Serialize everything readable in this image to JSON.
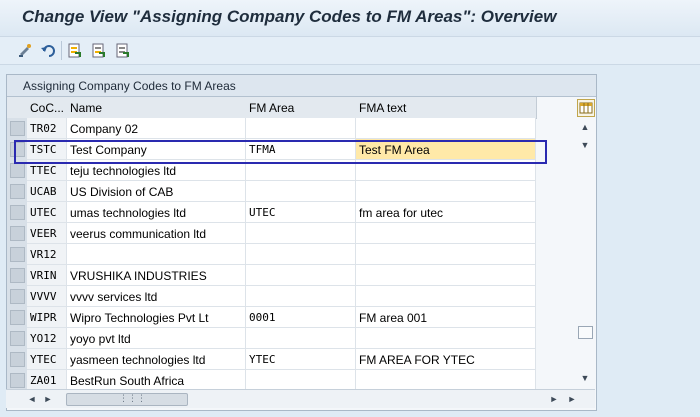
{
  "window": {
    "title": "Change View \"Assigning Company Codes to FM Areas\": Overview"
  },
  "toolbar": {
    "buttons": [
      {
        "icon": "display-change-icon"
      },
      {
        "icon": "undo-icon"
      },
      {
        "icon": "select-all-icon"
      },
      {
        "icon": "select-block-icon"
      },
      {
        "icon": "deselect-all-icon"
      }
    ]
  },
  "table": {
    "title": "Assigning Company Codes to FM Areas",
    "columns": [
      "CoC...",
      "Name",
      "FM Area",
      "FMA text"
    ],
    "rows": [
      {
        "code": "TR02",
        "name": "Company 02",
        "fm_area": "",
        "fma_text": ""
      },
      {
        "code": "TSTC",
        "name": "Test Company",
        "fm_area": "TFMA",
        "fma_text": "Test FM Area"
      },
      {
        "code": "TTEC",
        "name": "teju technologies ltd",
        "fm_area": "",
        "fma_text": ""
      },
      {
        "code": "UCAB",
        "name": "US Division of CAB",
        "fm_area": "",
        "fma_text": ""
      },
      {
        "code": "UTEC",
        "name": "umas technologies ltd",
        "fm_area": "UTEC",
        "fma_text": "fm area for utec"
      },
      {
        "code": "VEER",
        "name": "veerus communication ltd",
        "fm_area": "",
        "fma_text": ""
      },
      {
        "code": "VR12",
        "name": "",
        "fm_area": "",
        "fma_text": ""
      },
      {
        "code": "VRIN",
        "name": "VRUSHIKA INDUSTRIES",
        "fm_area": "",
        "fma_text": ""
      },
      {
        "code": "VVVV",
        "name": "vvvv services ltd",
        "fm_area": "",
        "fma_text": ""
      },
      {
        "code": "WIPR",
        "name": "Wipro Technologies Pvt Lt",
        "fm_area": "0001",
        "fma_text": "FM area 001"
      },
      {
        "code": "YO12",
        "name": "yoyo pvt ltd",
        "fm_area": "",
        "fma_text": ""
      },
      {
        "code": "YTEC",
        "name": "yasmeen technologies ltd",
        "fm_area": "YTEC",
        "fma_text": "FM AREA FOR YTEC"
      },
      {
        "code": "ZA01",
        "name": "BestRun South Africa",
        "fm_area": "",
        "fma_text": ""
      }
    ]
  },
  "scroll": {
    "up": "▲",
    "down": "▼",
    "left": "◄",
    "right": "►",
    "far_right": "►",
    "thumb": "⋮⋮⋮"
  }
}
